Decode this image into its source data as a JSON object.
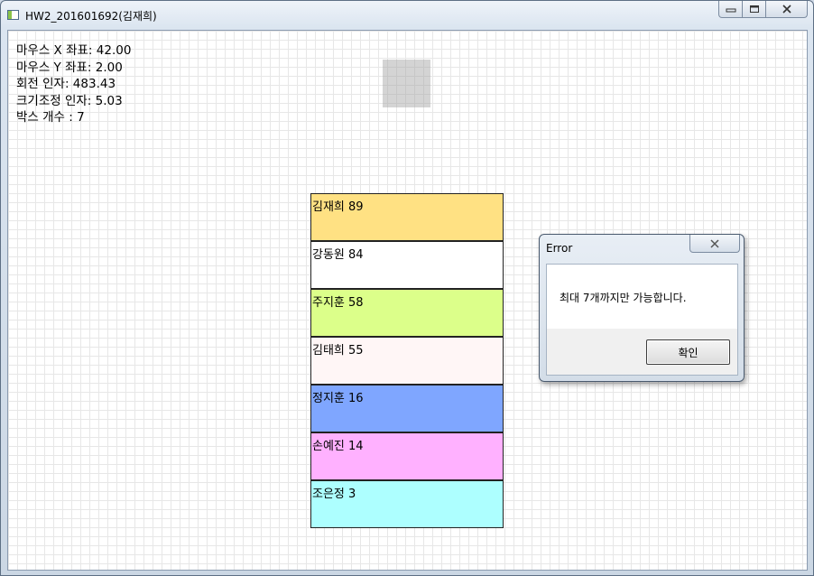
{
  "window": {
    "title": "HW2_201601692(김재희)",
    "min_icon": "minimize-icon",
    "max_icon": "maximize-icon",
    "close_icon": "close-icon"
  },
  "hud": {
    "mouse_x": "마우스 X 좌표: 42.00",
    "mouse_y": "마우스 Y 좌표: 2.00",
    "rotation": "회전 인자: 483.43",
    "scale": "크기조정 인자: 5.03",
    "box_count": "박스 개수 : 7"
  },
  "bars": [
    {
      "label": "김재희 89",
      "color": "#ffe183"
    },
    {
      "label": "강동원 84",
      "color": "#ffffff"
    },
    {
      "label": "주지훈 58",
      "color": "#dcff8a"
    },
    {
      "label": "김태희 55",
      "color": "#fff6f6"
    },
    {
      "label": "정지훈 16",
      "color": "#7fa6ff"
    },
    {
      "label": "손예진 14",
      "color": "#ffb1ff"
    },
    {
      "label": "조은정 3",
      "color": "#adffff"
    }
  ],
  "dialog": {
    "title": "Error",
    "message": "최대 7개까지만 가능합니다.",
    "ok_label": "확인",
    "close_icon": "close-icon"
  }
}
